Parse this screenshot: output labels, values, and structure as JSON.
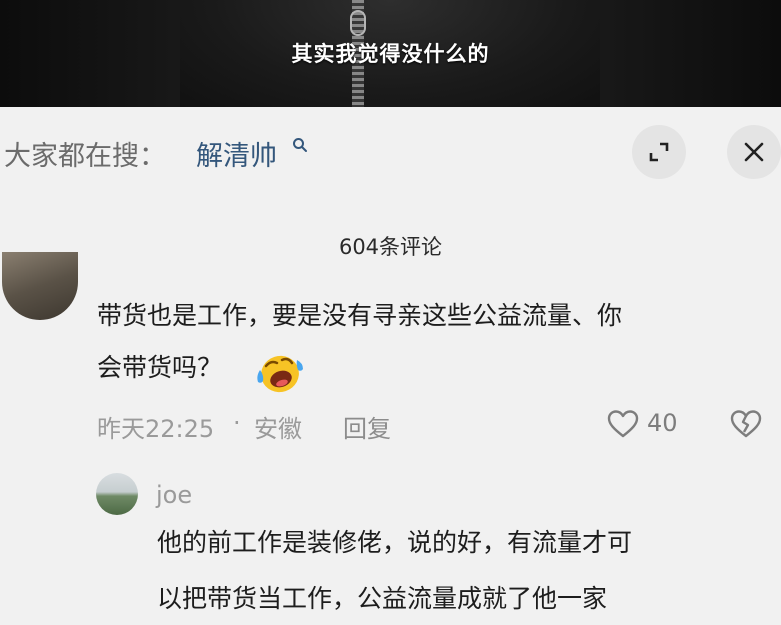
{
  "video": {
    "subtitle": "其实我觉得没什么的"
  },
  "search": {
    "prefix": "大家都在搜：",
    "term": "解清帅",
    "icons": [
      "search-icon",
      "expand-icon",
      "close-icon"
    ]
  },
  "comments": {
    "count_label": "604条评论",
    "items": [
      {
        "text_line1": "带货也是工作，要是没有寻亲这些公益流量、你",
        "text_line2": "会带货吗？",
        "emoji": "laughing-crying-emoji",
        "time": "昨天22:25",
        "separator": "·",
        "location": "安徽",
        "reply_label": "回复",
        "likes": "40"
      }
    ],
    "reply": {
      "name": "joe",
      "text_line1": "他的前工作是装修佬，说的好，有流量才可",
      "text_line2": "以把带货当工作，公益流量成就了他一家"
    }
  },
  "colors": {
    "background": "#f1f1f1",
    "search_term": "#34577c",
    "meta_text": "#9a9a9a",
    "primary_text": "#1d1d1d"
  }
}
